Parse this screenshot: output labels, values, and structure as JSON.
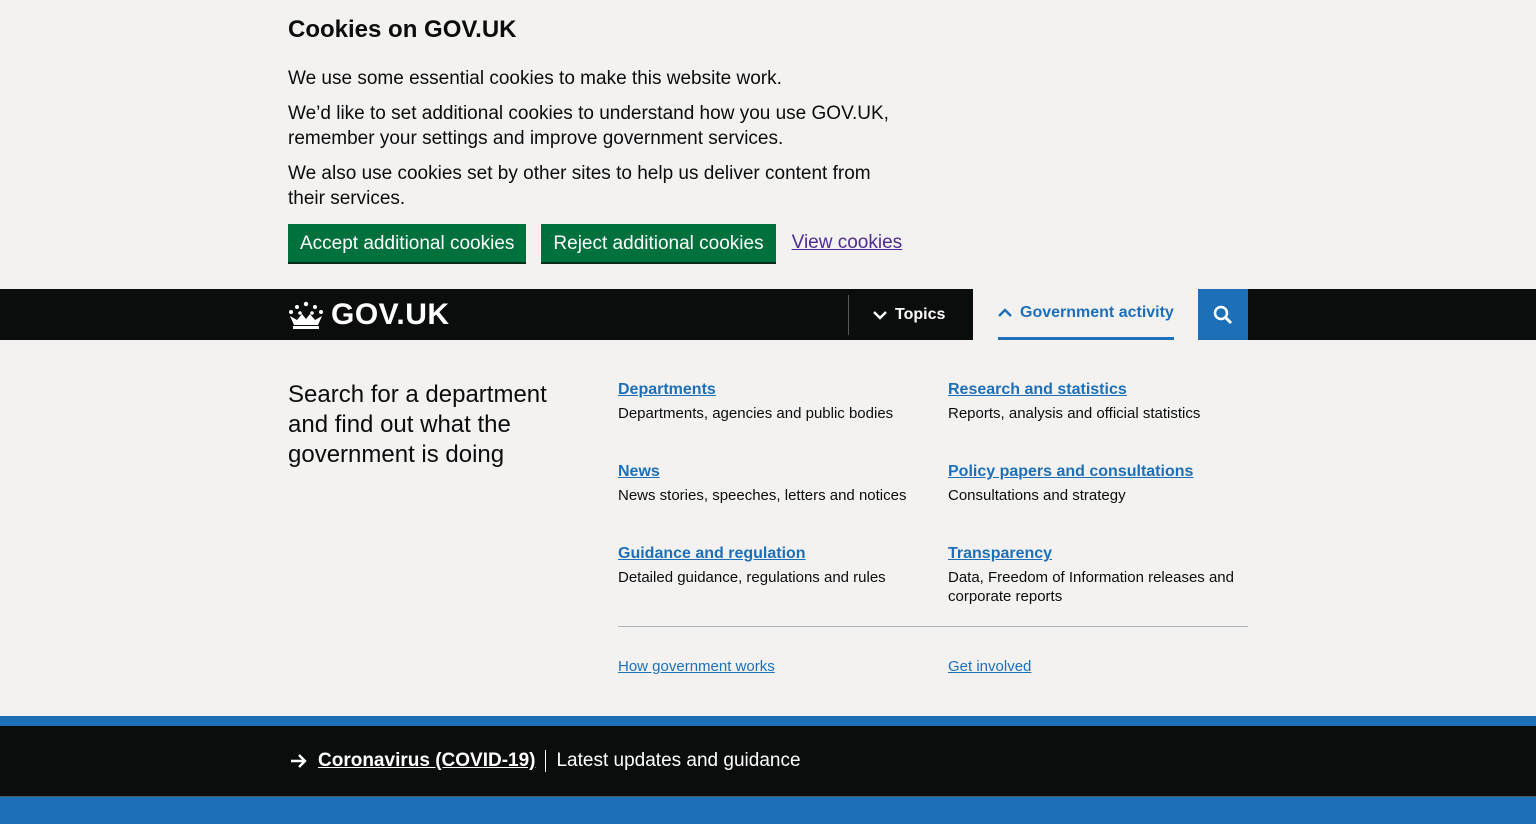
{
  "cookie_banner": {
    "title": "Cookies on GOV.UK",
    "paragraphs": [
      "We use some essential cookies to make this website work.",
      "We’d like to set additional cookies to understand how you use GOV.UK, remember your settings and improve government services.",
      "We also use cookies set by other sites to help us deliver content from their services."
    ],
    "accept_label": "Accept additional cookies",
    "reject_label": "Reject additional cookies",
    "view_label": "View cookies"
  },
  "header": {
    "logo_text": "GOV.UK",
    "topics_label": "Topics",
    "government_activity_label": "Government activity",
    "search_icon": "search-icon"
  },
  "menu": {
    "lead": "Search for a department and find out what the government is doing",
    "items": [
      {
        "label": "Departments",
        "desc": "Departments, agencies and public bodies"
      },
      {
        "label": "Research and statistics",
        "desc": "Reports, analysis and official statistics"
      },
      {
        "label": "News",
        "desc": "News stories, speeches, letters and notices"
      },
      {
        "label": "Policy papers and consultations",
        "desc": "Consultations and strategy"
      },
      {
        "label": "Guidance and regulation",
        "desc": "Detailed guidance, regulations and rules"
      },
      {
        "label": "Transparency",
        "desc": "Data, Freedom of Information releases and corporate reports"
      }
    ],
    "footer_links": [
      {
        "label": "How government works"
      },
      {
        "label": "Get involved"
      }
    ]
  },
  "covid_banner": {
    "link_label": "Coronavirus (COVID-19)",
    "text": "Latest updates and guidance"
  },
  "colors": {
    "black": "#0b0c0c",
    "link_blue": "#1d70b8",
    "green": "#00703c",
    "visited_purple": "#4c2c92",
    "background": "#f3f2f1"
  }
}
